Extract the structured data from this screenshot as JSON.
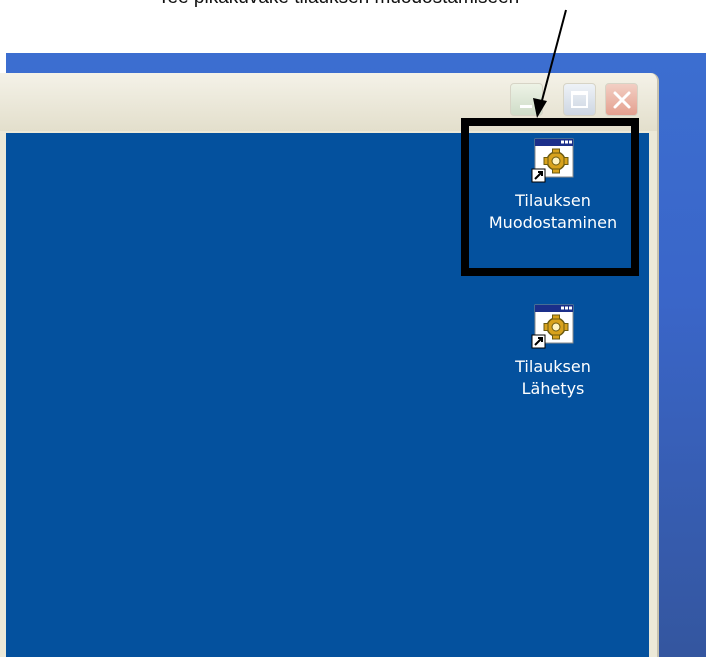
{
  "caption": {
    "text": "Tee pikakuvake tilauksen muodostamiseen"
  },
  "window": {
    "controls": {
      "minimize": "minimize",
      "maximize": "maximize",
      "close": "close"
    }
  },
  "desktop_icons": [
    {
      "label_line1": "Tilauksen",
      "label_line2": "Muodostaminen",
      "icon": "program-shortcut-icon"
    },
    {
      "label_line1": "Tilauksen",
      "label_line2": "Lähetys",
      "icon": "program-shortcut-icon"
    }
  ],
  "colors": {
    "client_background": "#04519e",
    "desktop_background": "#3a66c9",
    "highlight_border": "#000000"
  }
}
